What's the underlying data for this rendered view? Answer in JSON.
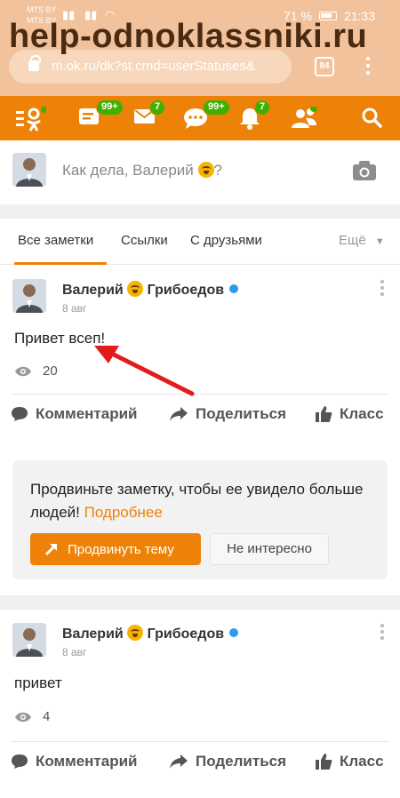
{
  "status_bar": {
    "carrier1": "MTS BY",
    "carrier2": "MTS BY",
    "battery": "71 %",
    "time": "21:33"
  },
  "watermark": "help-odnoklassniki.ru",
  "browser": {
    "url": "m.ok.ru/dk?st.cmd=userStatuses&",
    "tabs_count": "84"
  },
  "nav": {
    "messages_badge": "99+",
    "mail_badge": "7",
    "discussions_badge": "99+",
    "notifications_badge": "7"
  },
  "composer": {
    "placeholder_before": "Как дела, Валерий",
    "placeholder_after": "?"
  },
  "filter_tabs": {
    "all_notes": "Все заметки",
    "links": "Ссылки",
    "with_friends": "С друзьями",
    "more": "Ещё"
  },
  "posts": [
    {
      "author_first": "Валерий",
      "author_last": "Грибоедов",
      "date": "8 авг",
      "text": "Привет всеп!",
      "views": "20",
      "comment": "Комментарий",
      "share": "Поделиться",
      "like": "Класс"
    },
    {
      "author_first": "Валерий",
      "author_last": "Грибоедов",
      "date": "8 авг",
      "text": "привет",
      "views": "4",
      "comment": "Комментарий",
      "share": "Поделиться",
      "like": "Класс"
    }
  ],
  "promo": {
    "text": "Продвиньте заметку, чтобы ее увидело больше людей!",
    "link": "Подробнее",
    "promote_button": "Продвинуть тему",
    "dismiss_button": "Не интересно"
  },
  "colors": {
    "accent": "#ee8208",
    "badge": "#3fb000",
    "verified": "#2a9cf0",
    "arrow": "#e31b1b"
  }
}
